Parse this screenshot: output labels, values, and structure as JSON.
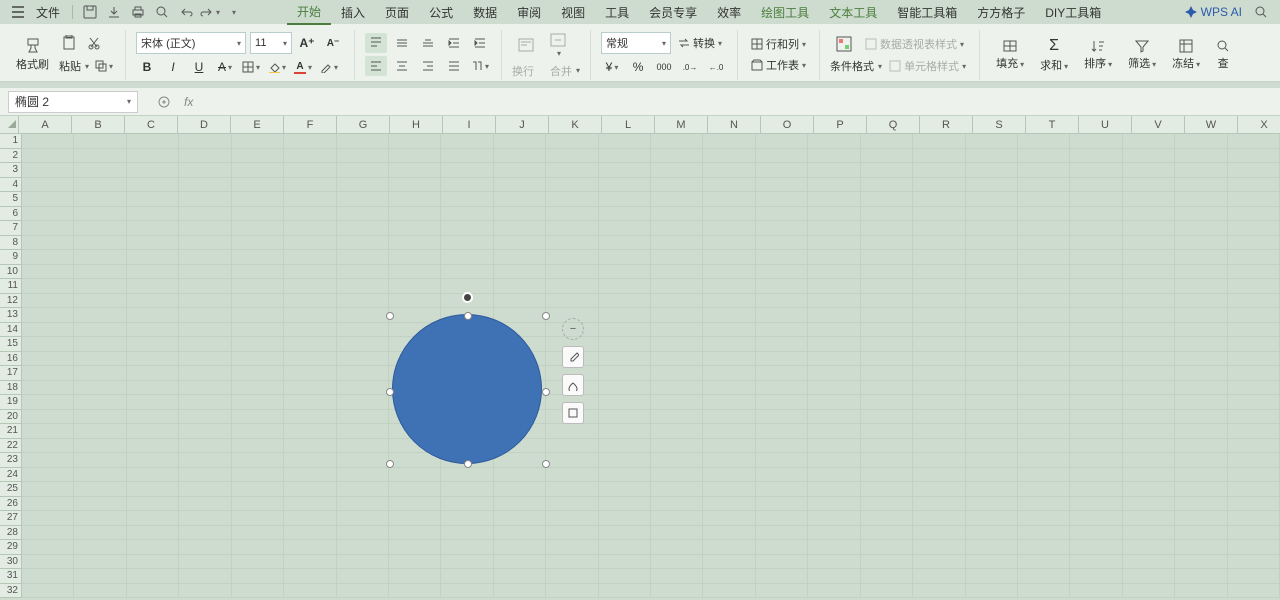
{
  "menubar": {
    "file": "文件",
    "wps_ai": "WPS AI"
  },
  "tabs": {
    "items": [
      "开始",
      "插入",
      "页面",
      "公式",
      "数据",
      "审阅",
      "视图",
      "工具",
      "会员专享",
      "效率",
      "绘图工具",
      "文本工具",
      "智能工具箱",
      "方方格子",
      "DIY工具箱"
    ],
    "active_index": 0,
    "green_start_index": 10
  },
  "ribbon": {
    "format_painter": "格式刷",
    "paste": "粘贴",
    "font_name": "宋体 (正文)",
    "font_size": "11",
    "number_format": "常规",
    "convert": "转换",
    "rows_cols": "行和列",
    "worksheet": "工作表",
    "cond_format": "条件格式",
    "pivot_style": "数据透视表样式",
    "cell_style": "单元格样式",
    "fill": "填充",
    "sum": "求和",
    "sort": "排序",
    "filter": "筛选",
    "freeze": "冻结",
    "find": "查",
    "wrap": "换行",
    "merge": "合并"
  },
  "namebox": {
    "value": "椭圆 2"
  },
  "formula_bar": {
    "fx": "fx"
  },
  "grid": {
    "columns": [
      "A",
      "B",
      "C",
      "D",
      "E",
      "F",
      "G",
      "H",
      "I",
      "J",
      "K",
      "L",
      "M",
      "N",
      "O",
      "P",
      "Q",
      "R",
      "S",
      "T",
      "U",
      "V",
      "W",
      "X"
    ],
    "rows": 32
  },
  "shape": {
    "fill": "#3f72b5"
  }
}
